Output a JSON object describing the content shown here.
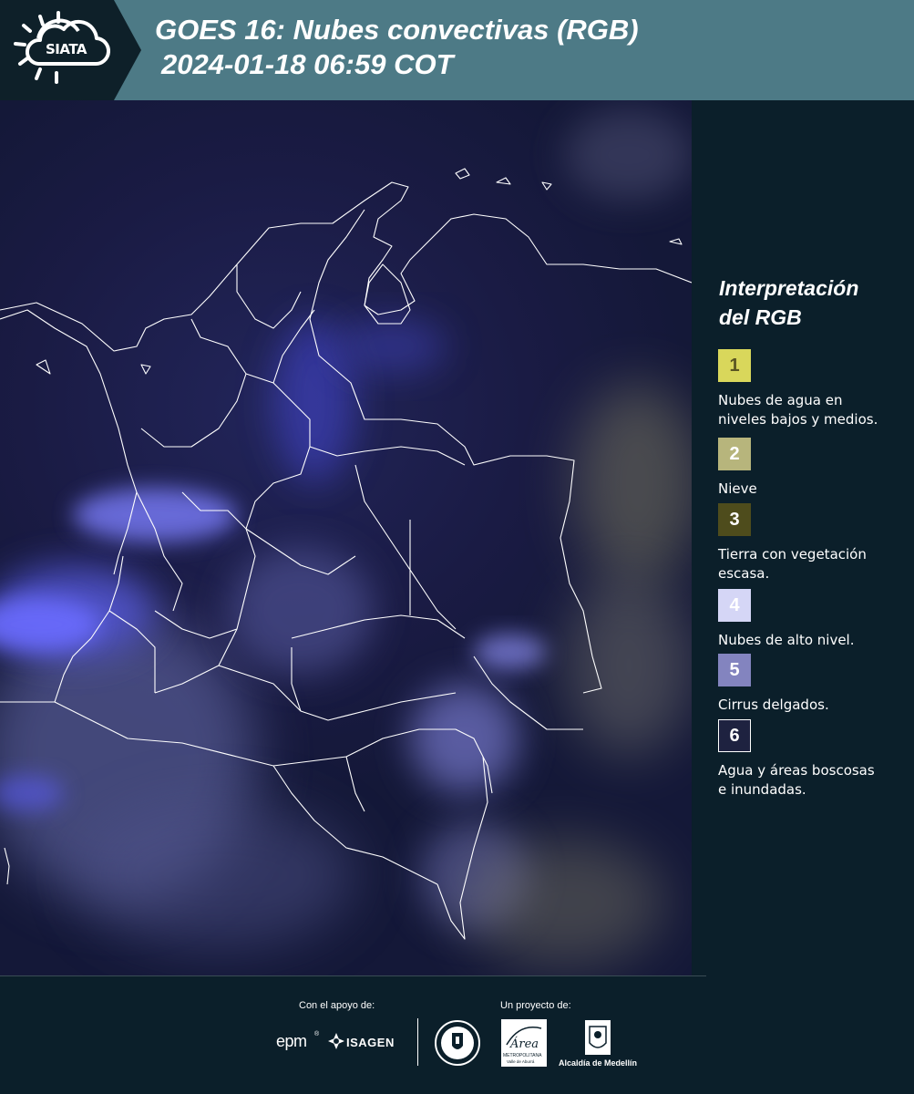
{
  "header": {
    "logo_text": "SIATA",
    "title_line1": "GOES 16: Nubes convectivas (RGB)",
    "title_line2": "2024-01-18 06:59 COT"
  },
  "legend": {
    "title_line1": "Interpretación",
    "title_line2": "del RGB",
    "items": [
      {
        "number": "1",
        "color": "#d9d75b",
        "text_color": "#5a5522",
        "line1": "Nubes de agua en",
        "line2": "niveles bajos y medios."
      },
      {
        "number": "2",
        "color": "#b7b57c",
        "text_color": "#ffffff",
        "line1": "Nieve",
        "line2": ""
      },
      {
        "number": "3",
        "color": "#4e4c1c",
        "text_color": "#ffffff",
        "line1": "Tierra con vegetación",
        "line2": "escasa."
      },
      {
        "number": "4",
        "color": "#d5d6f6",
        "text_color": "#ffffff",
        "line1": "Nubes de alto nivel.",
        "line2": ""
      },
      {
        "number": "5",
        "color": "#8384bf",
        "text_color": "#ffffff",
        "line1": "Cirrus delgados.",
        "line2": ""
      },
      {
        "number": "6",
        "color": "#1e2240",
        "text_color": "#ffffff",
        "line1": "Agua y áreas boscosas",
        "line2": "e inundadas."
      }
    ]
  },
  "footer": {
    "support_caption": "Con el apoyo de:",
    "project_caption": "Un proyecto de:",
    "sponsor_epm": "epm",
    "sponsor_isagen": "ISAGEN",
    "partner_area_top": "Área",
    "partner_area_sub1": "METROPOLITANA",
    "partner_area_sub2": "Valle de Aburrá",
    "partner_alcaldia": "Alcaldía de Medellín"
  },
  "colors": {
    "header_bg": "#4d7a86",
    "panel_bg": "#0b1f2a",
    "map_bg": "#1a1b44",
    "high_cloud": "#4a4dff",
    "border_lines": "#ffffff"
  }
}
